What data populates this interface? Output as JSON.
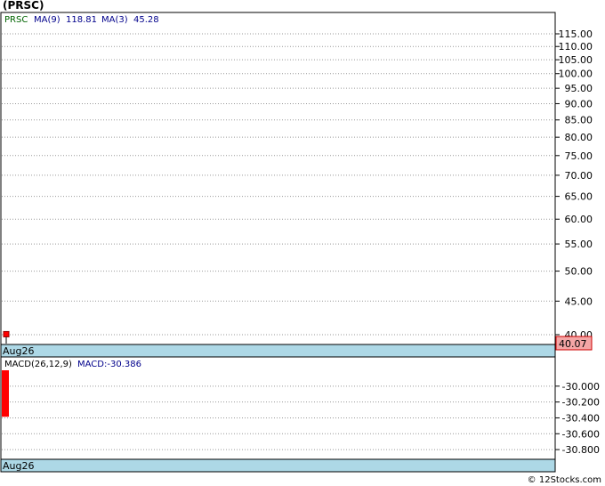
{
  "title": "(PRSC)",
  "footer": "© 12Stocks.com",
  "price_panel": {
    "legend": {
      "symbol": "PRSC",
      "ma9_label": "MA(9)",
      "ma9_value": "118.81",
      "ma3_label": "MA(3)",
      "ma3_value": "45.28"
    },
    "last_price_badge": "40.07",
    "date_label": "Aug26"
  },
  "macd_panel": {
    "legend": "MACD(26,12,9)",
    "value_label": "MACD:-30.386",
    "date_label": "Aug26"
  },
  "colors": {
    "symbol_green": "#006400",
    "ma_blue": "#00008b",
    "bar_red": "#ff0000",
    "badge_bg": "#f4a6a6",
    "date_bar": "#add8e6",
    "grid": "#999999"
  },
  "chart_data": [
    {
      "type": "bar",
      "panel": "price",
      "scale": "log",
      "y_ticks": [
        40,
        45,
        50,
        55,
        60,
        65,
        70,
        75,
        80,
        85,
        90,
        95,
        100,
        105,
        110,
        115
      ],
      "y_tick_labels": [
        "40.00",
        "45.00",
        "50.00",
        "55.00",
        "60.00",
        "65.00",
        "70.00",
        "75.00",
        "80.00",
        "85.00",
        "90.00",
        "95.00",
        "100.00",
        "105.00",
        "110.00",
        "115.00"
      ],
      "x": [
        "Aug26"
      ],
      "values": [
        40.07
      ],
      "grid": true
    },
    {
      "type": "bar",
      "panel": "macd",
      "y_ticks": [
        -30.0,
        -30.2,
        -30.4,
        -30.6,
        -30.8
      ],
      "y_tick_labels": [
        "-30.000",
        "-30.200",
        "-30.400",
        "-30.600",
        "-30.800"
      ],
      "ylim": [
        -30.9,
        -29.8
      ],
      "x": [
        "Aug26"
      ],
      "values": [
        -30.386
      ],
      "grid": true
    }
  ]
}
